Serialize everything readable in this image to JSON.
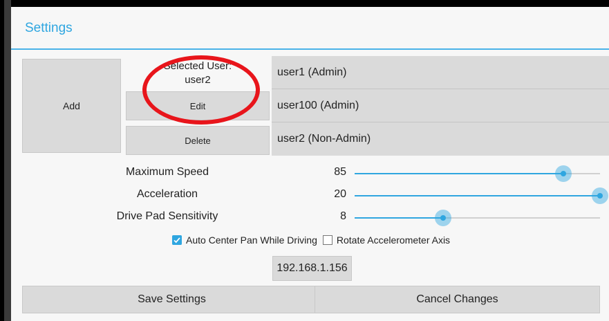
{
  "dialog": {
    "title": "Settings"
  },
  "users": {
    "add_label": "Add",
    "selected_user_heading": "Selected User:",
    "selected_user_name": "user2",
    "edit_label": "Edit",
    "delete_label": "Delete",
    "list": [
      {
        "label": "user1 (Admin)"
      },
      {
        "label": "user100 (Admin)"
      },
      {
        "label": "user2 (Non-Admin)"
      }
    ]
  },
  "sliders": [
    {
      "label": "Maximum Speed",
      "value": "85",
      "fraction": 0.85
    },
    {
      "label": "Acceleration",
      "value": "20",
      "fraction": 1.0
    },
    {
      "label": "Drive Pad Sensitivity",
      "value": "8",
      "fraction": 0.36
    }
  ],
  "options": {
    "auto_center_label": "Auto Center Pan While Driving",
    "auto_center_checked": true,
    "rotate_accel_label": "Rotate Accelerometer Axis",
    "rotate_accel_checked": false
  },
  "network": {
    "ip_address": "192.168.1.156"
  },
  "footer": {
    "save_label": "Save Settings",
    "cancel_label": "Cancel Changes"
  },
  "colors": {
    "accent": "#2fa6e0",
    "annotation": "#e8151b"
  }
}
